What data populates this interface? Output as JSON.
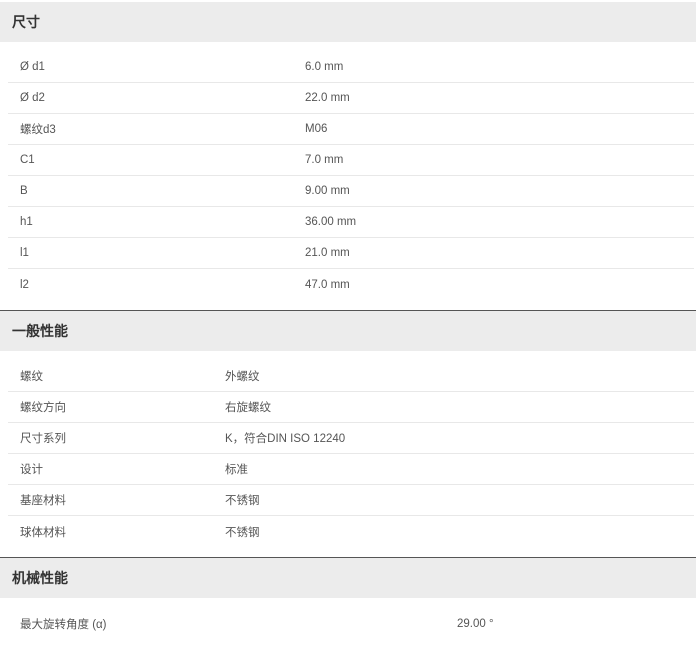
{
  "sections": {
    "dimensions": {
      "title": "尺寸",
      "rows": [
        {
          "label": "Ø d1",
          "value": "6.0 mm"
        },
        {
          "label": "Ø d2",
          "value": "22.0 mm"
        },
        {
          "label": "螺纹d3",
          "value": "M06"
        },
        {
          "label": "C1",
          "value": "7.0 mm"
        },
        {
          "label": "B",
          "value": "9.00 mm"
        },
        {
          "label": "h1",
          "value": "36.00 mm"
        },
        {
          "label": "l1",
          "value": "21.0 mm"
        },
        {
          "label": "l2",
          "value": "47.0 mm"
        }
      ]
    },
    "general": {
      "title": "一般性能",
      "rows": [
        {
          "label": "螺纹",
          "value": "外螺纹"
        },
        {
          "label": "螺纹方向",
          "value": "右旋螺纹"
        },
        {
          "label": "尺寸系列",
          "value": "K，符合DIN ISO 12240"
        },
        {
          "label": "设计",
          "value": "标准"
        },
        {
          "label": "基座材料",
          "value": "不锈钢"
        },
        {
          "label": "球体材料",
          "value": "不锈钢"
        }
      ]
    },
    "mechanical": {
      "title": "机械性能",
      "rows": [
        {
          "label": "最大旋转角度 (α)",
          "value": "29.00 °"
        }
      ]
    }
  }
}
